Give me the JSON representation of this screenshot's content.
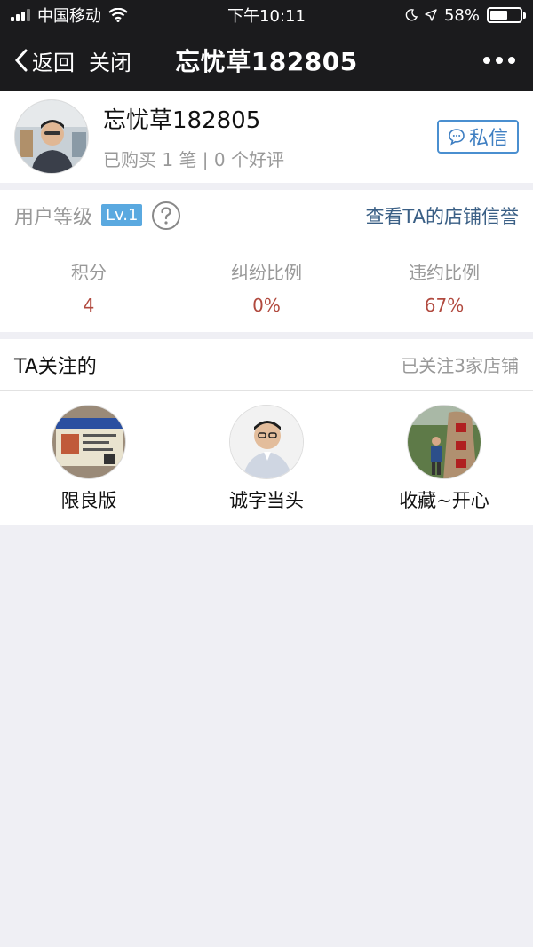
{
  "status_bar": {
    "carrier": "中国移动",
    "time": "下午10:11",
    "battery": "58%",
    "battery_level": 0.58
  },
  "nav": {
    "back_label": "返回",
    "close_label": "关闭",
    "title": "忘忧草182805"
  },
  "profile": {
    "name": "忘忧草182805",
    "stats": "已购买 1 笔 | 0 个好评",
    "message_button": "私信"
  },
  "level": {
    "label": "用户等级",
    "badge": "Lv.1",
    "credit_link": "查看TA的店铺信誉"
  },
  "stats": [
    {
      "label": "积分",
      "value": "4"
    },
    {
      "label": "纠纷比例",
      "value": "0%"
    },
    {
      "label": "违约比例",
      "value": "67%"
    }
  ],
  "following": {
    "title": "TA关注的",
    "count_text": "已关注3家店铺",
    "shops": [
      {
        "name": "限良版"
      },
      {
        "name": "诚字当头"
      },
      {
        "name": "收藏~开心"
      }
    ]
  }
}
